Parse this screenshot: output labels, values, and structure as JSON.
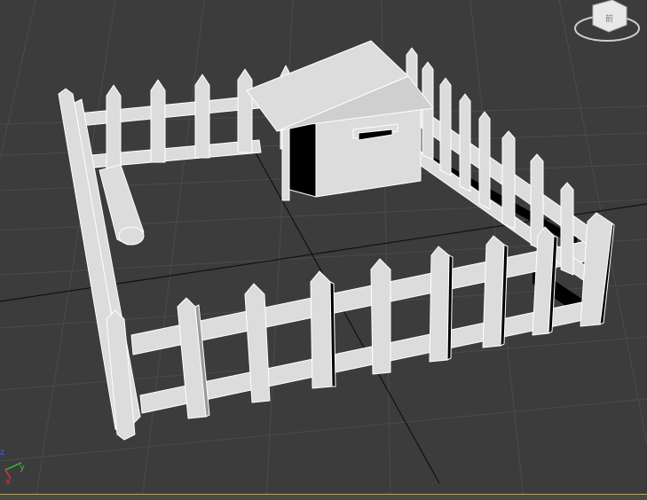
{
  "viewport": {
    "background": "#3c3c3c",
    "grid_color": "#4b4b4b",
    "object_fill": "#dcdcdc",
    "object_edge": "#ffffff",
    "shadow_fill": "#000000"
  },
  "viewcube": {
    "face_label": "前"
  },
  "axis_gizmo": {
    "x": "x",
    "y": "y",
    "z": "z",
    "x_color": "#e03030",
    "y_color": "#34c034",
    "z_color": "#3a5cff"
  },
  "scene_objects": [
    "fence",
    "dog-house",
    "feeding-trough"
  ]
}
